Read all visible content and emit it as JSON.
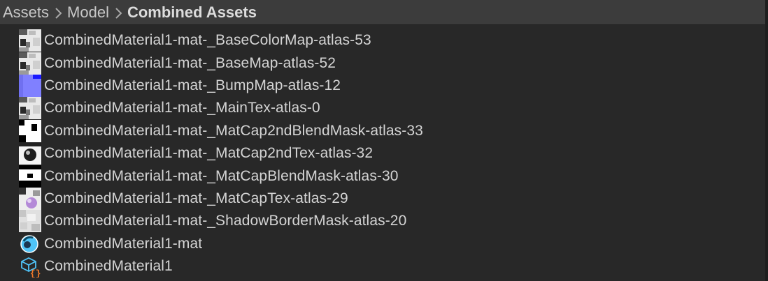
{
  "breadcrumb": {
    "items": [
      "Assets",
      "Model",
      "Combined Assets"
    ]
  },
  "assets": [
    {
      "label": "CombinedMaterial1-mat-_BaseColorMap-atlas-53",
      "icon": "texture-thumbnail-icon"
    },
    {
      "label": "CombinedMaterial1-mat-_BaseMap-atlas-52",
      "icon": "texture-thumbnail-icon"
    },
    {
      "label": "CombinedMaterial1-mat-_BumpMap-atlas-12",
      "icon": "normal-map-thumbnail-icon"
    },
    {
      "label": "CombinedMaterial1-mat-_MainTex-atlas-0",
      "icon": "texture-thumbnail-icon"
    },
    {
      "label": "CombinedMaterial1-mat-_MatCap2ndBlendMask-atlas-33",
      "icon": "mask-thumbnail-icon"
    },
    {
      "label": "CombinedMaterial1-mat-_MatCap2ndTex-atlas-32",
      "icon": "matcap-thumbnail-icon"
    },
    {
      "label": "CombinedMaterial1-mat-_MatCapBlendMask-atlas-30",
      "icon": "mask-thumbnail-icon"
    },
    {
      "label": "CombinedMaterial1-mat-_MatCapTex-atlas-29",
      "icon": "matcap-thumbnail-icon"
    },
    {
      "label": "CombinedMaterial1-mat-_ShadowBorderMask-atlas-20",
      "icon": "shadow-mask-thumbnail-icon"
    },
    {
      "label": "CombinedMaterial1-mat",
      "icon": "material-sphere-icon"
    },
    {
      "label": "CombinedMaterial1",
      "icon": "script-asset-icon"
    }
  ],
  "colors": {
    "background": "#282828",
    "breadcrumb_bar": "#3c3c3c",
    "text": "#d4d4d4",
    "material_icon": "#4fc3f7",
    "script_icon_orange": "#f07a2a"
  }
}
